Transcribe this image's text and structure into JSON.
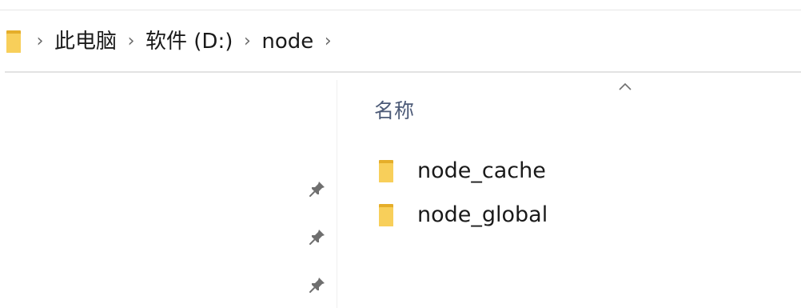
{
  "address_bar": {
    "crumbs": [
      "此电脑",
      "软件 (D:)",
      "node"
    ]
  },
  "file_list": {
    "column_name": "名称",
    "items": [
      {
        "name": "node_cache",
        "icon": "folder-icon"
      },
      {
        "name": "node_global",
        "icon": "folder-icon"
      }
    ]
  },
  "nav_pane": {
    "pins": [
      "pin-icon",
      "pin-icon",
      "pin-icon"
    ]
  },
  "colors": {
    "folder_yellow": "#f8cf5a",
    "folder_dark": "#e5ae2a",
    "header_text": "#4d5b78",
    "chevron": "#6b6b6b"
  }
}
